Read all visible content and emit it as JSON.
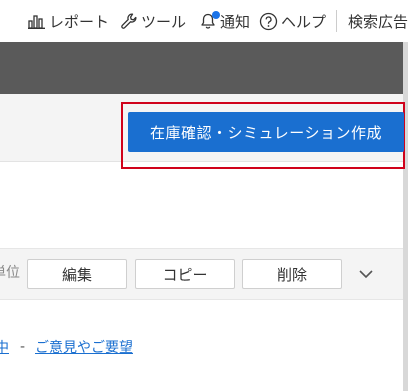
{
  "nav": {
    "report_label": "レポート",
    "tools_label": "ツール",
    "notify_label": "通知",
    "help_label": "ヘルプ",
    "search_label": "検索広告"
  },
  "action": {
    "primary_label": "在庫確認・シミュレーション作成"
  },
  "toolbar": {
    "unit_label_fragment": "単位",
    "edit_label": "編集",
    "copy_label": "コピー",
    "delete_label": "削除"
  },
  "footer": {
    "cut_link_fragment": "中",
    "separator": "-",
    "feedback_label": "ご意見やご要望"
  },
  "colors": {
    "primary": "#1a6fd0",
    "highlight": "#d0021b",
    "darkbar": "#5a5a5a"
  }
}
